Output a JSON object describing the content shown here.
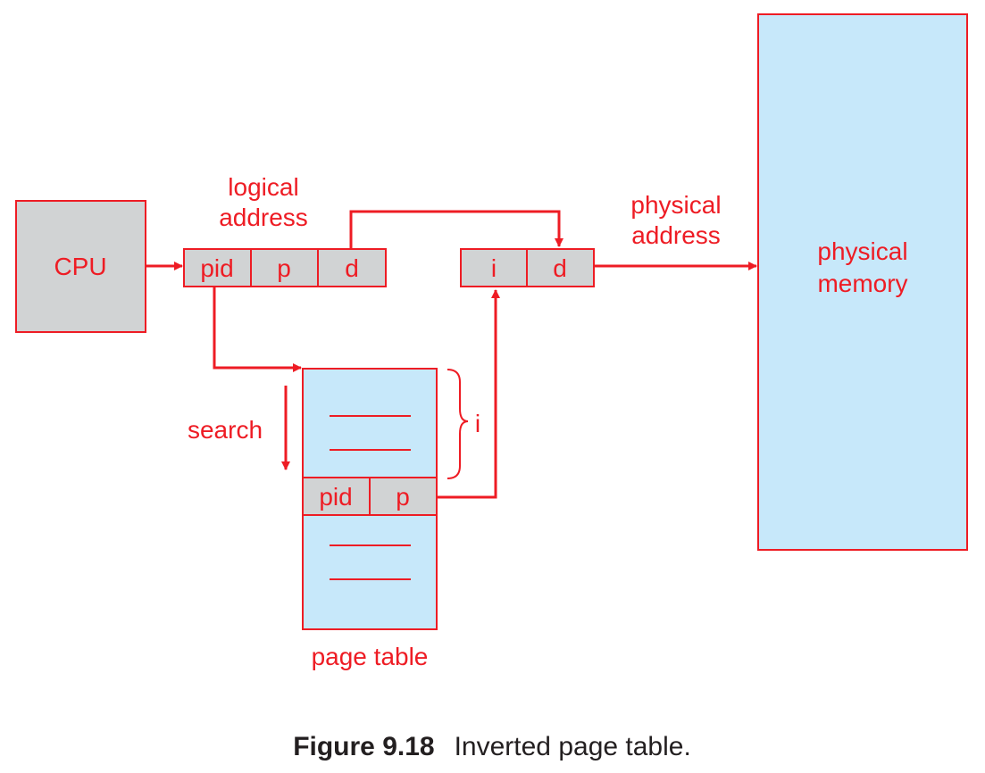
{
  "colors": {
    "accent": "#ee1c24",
    "gray_box": "#d1d3d4",
    "blue_box": "#c7e8fa",
    "caption": "#231f20"
  },
  "cpu": {
    "label": "CPU"
  },
  "logical_address": {
    "label_line1": "logical",
    "label_line2": "address",
    "fields": [
      "pid",
      "p",
      "d"
    ]
  },
  "physical_address": {
    "label_line1": "physical",
    "label_line2": "address",
    "fields": [
      "i",
      "d"
    ]
  },
  "physical_memory": {
    "label_line1": "physical",
    "label_line2": "memory"
  },
  "page_table": {
    "label": "page table",
    "entry_fields": [
      "pid",
      "p"
    ],
    "index_label": "i"
  },
  "search": {
    "label": "search"
  },
  "caption": {
    "figure": "Figure 9.18",
    "text": "Inverted page table."
  }
}
